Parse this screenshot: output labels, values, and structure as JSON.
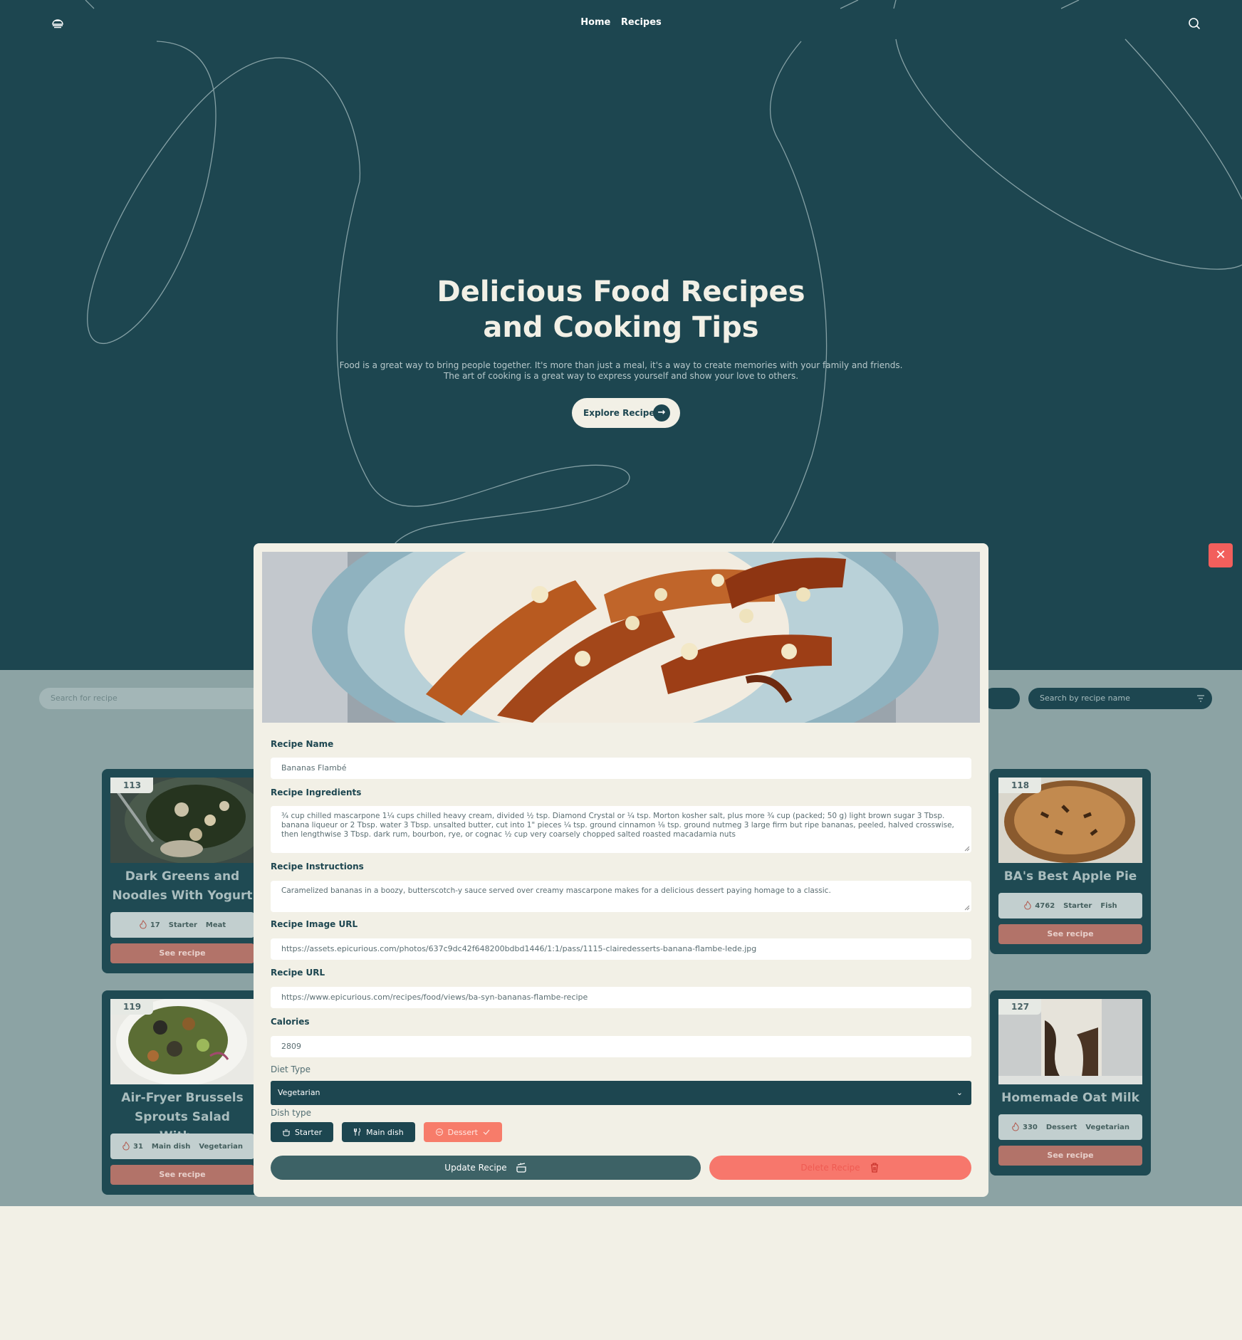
{
  "nav": {
    "links": [
      "Home",
      "Recipes"
    ]
  },
  "hero": {
    "title_line1": "Delicious Food Recipes",
    "title_line2": "and Cooking Tips",
    "subtitle_line1": "Food is a great way to bring people together. It's more than just a meal, it's a way to create memories with your family and friends.",
    "subtitle_line2": "The art of cooking is a great way to express yourself and show your love to others.",
    "cta_label": "Explore Recipes"
  },
  "search": {
    "left_placeholder": "Search for recipe",
    "right_placeholder": "Search by recipe name"
  },
  "cards": [
    {
      "id": "113",
      "title_line1": "Dark Greens and",
      "title_line2": "Noodles With Yogurt",
      "calories": "17",
      "tags": [
        "Starter",
        "Meat"
      ],
      "button": "See recipe"
    },
    {
      "id": "119",
      "title_line1": "Air-Fryer Brussels",
      "title_line2": "Sprouts Salad With...",
      "calories": "31",
      "tags": [
        "Main dish",
        "Vegetarian"
      ],
      "button": "See recipe"
    },
    {
      "id": "118",
      "title_line1": "BA's Best Apple Pie",
      "calories": "4762",
      "tags": [
        "Starter",
        "Fish"
      ],
      "button": "See recipe"
    },
    {
      "id": "127",
      "title_line1": "Homemade Oat Milk",
      "calories": "330",
      "tags": [
        "Dessert",
        "Vegetarian"
      ],
      "button": "See recipe"
    }
  ],
  "modal": {
    "labels": {
      "name": "Recipe Name",
      "ingredients": "Recipe Ingredients",
      "instructions": "Recipe Instructions",
      "image_url": "Recipe Image URL",
      "url": "Recipe URL",
      "calories": "Calories",
      "diet_type": "Diet Type",
      "dish_type": "Dish type"
    },
    "values": {
      "name": "Bananas Flambé",
      "ingredients": "¾ cup chilled mascarpone 1¼ cups chilled heavy cream, divided ½ tsp. Diamond Crystal or ¼ tsp. Morton kosher salt, plus more ¾ cup (packed; 50 g) light brown sugar 3 Tbsp. banana liqueur or 2 Tbsp. water 3 Tbsp. unsalted butter, cut into 1\" pieces ¼ tsp. ground cinnamon ⅛ tsp. ground nutmeg 3 large firm but ripe bananas, peeled, halved crosswise, then lengthwise 3 Tbsp. dark rum, bourbon, rye, or cognac ½ cup very coarsely chopped salted roasted macadamia nuts",
      "instructions": "Caramelized bananas in a boozy, butterscotch-y sauce served over creamy mascarpone makes for a delicious dessert paying homage to a classic.",
      "image_url": "https://assets.epicurious.com/photos/637c9dc42f648200bdbd1446/1:1/pass/1115-clairedesserts-banana-flambe-lede.jpg",
      "url": "https://www.epicurious.com/recipes/food/views/ba-syn-bananas-flambe-recipe",
      "calories": "2809",
      "diet_type": "Vegetarian"
    },
    "dish_types": [
      {
        "label": "Starter",
        "selected": false
      },
      {
        "label": "Main dish",
        "selected": false
      },
      {
        "label": "Dessert",
        "selected": true
      }
    ],
    "update_label": "Update Recipe",
    "delete_label": "Delete Recipe",
    "close_label": "✕"
  },
  "colors": {
    "primary": "#1d4650",
    "cream": "#f2f0e6",
    "accent": "#f77c6a",
    "danger": "#f25f5c"
  }
}
